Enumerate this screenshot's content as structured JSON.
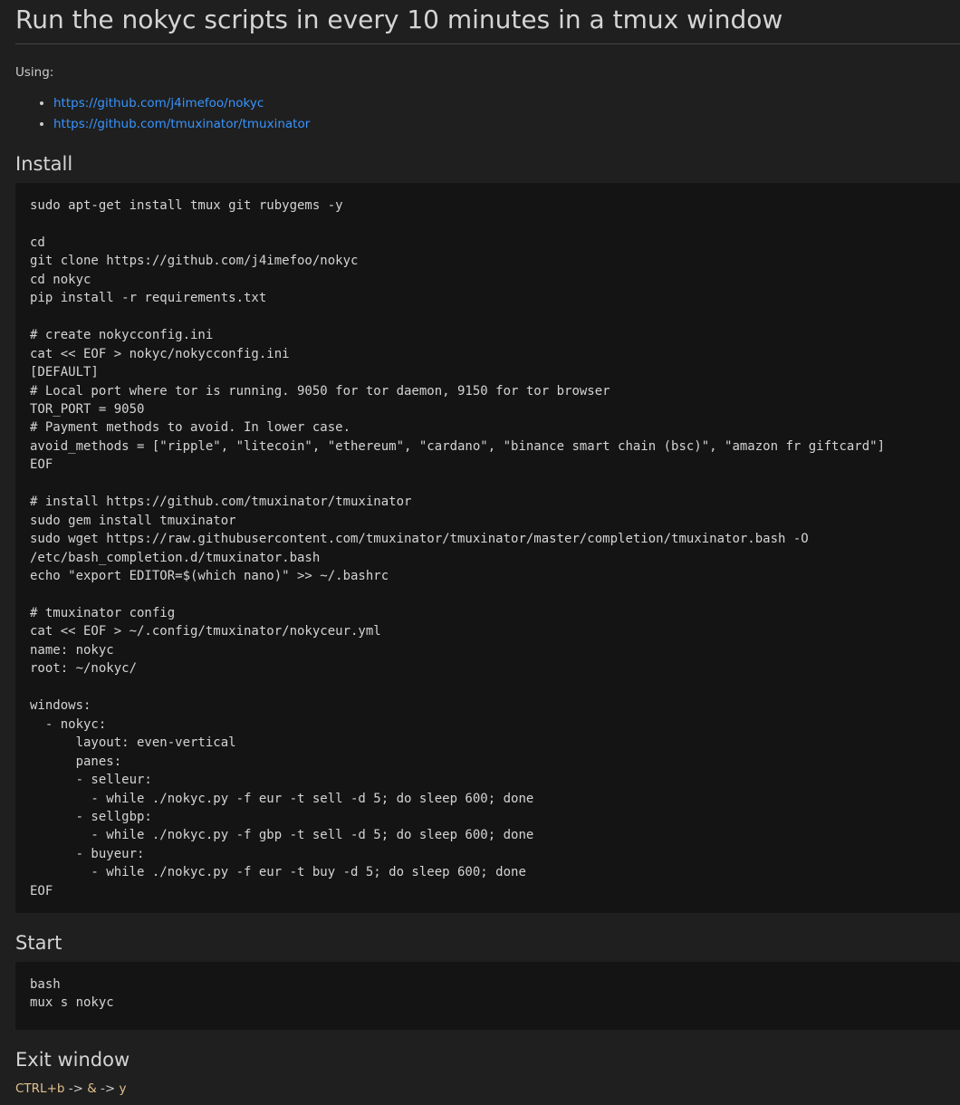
{
  "title": "Run the nokyc scripts in every 10 minutes in a tmux window",
  "using_label": "Using:",
  "links": [
    "https://github.com/j4imefoo/nokyc",
    "https://github.com/tmuxinator/tmuxinator"
  ],
  "install": {
    "heading": "Install",
    "code": "sudo apt-get install tmux git rubygems -y\n\ncd\ngit clone https://github.com/j4imefoo/nokyc\ncd nokyc\npip install -r requirements.txt\n\n# create nokycconfig.ini\ncat << EOF > nokyc/nokycconfig.ini\n[DEFAULT]\n# Local port where tor is running. 9050 for tor daemon, 9150 for tor browser\nTOR_PORT = 9050\n# Payment methods to avoid. In lower case.\navoid_methods = [\"ripple\", \"litecoin\", \"ethereum\", \"cardano\", \"binance smart chain (bsc)\", \"amazon fr giftcard\"]\nEOF\n\n# install https://github.com/tmuxinator/tmuxinator\nsudo gem install tmuxinator\nsudo wget https://raw.githubusercontent.com/tmuxinator/tmuxinator/master/completion/tmuxinator.bash -O\n/etc/bash_completion.d/tmuxinator.bash\necho \"export EDITOR=$(which nano)\" >> ~/.bashrc\n\n# tmuxinator config\ncat << EOF > ~/.config/tmuxinator/nokyceur.yml\nname: nokyc\nroot: ~/nokyc/\n\nwindows:\n  - nokyc:\n      layout: even-vertical\n      panes:\n      - selleur:\n        - while ./nokyc.py -f eur -t sell -d 5; do sleep 600; done\n      - sellgbp:\n        - while ./nokyc.py -f gbp -t sell -d 5; do sleep 600; done\n      - buyeur:\n        - while ./nokyc.py -f eur -t buy -d 5; do sleep 600; done\nEOF"
  },
  "start": {
    "heading": "Start",
    "code": "bash\nmux s nokyc"
  },
  "exit": {
    "heading": "Exit window",
    "keys": [
      "CTRL+b",
      "&",
      "y"
    ],
    "separator": " -> "
  }
}
